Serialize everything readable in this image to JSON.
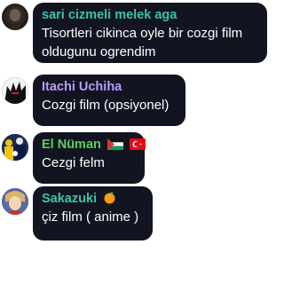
{
  "messages": [
    {
      "username": "sari cizmeli melek aga",
      "username_color": "#3fc1a8",
      "text_line1": "Tisortleri cikinca oyle bir cozgi film",
      "text_line2": "oldugunu ogrendim",
      "avatar_icon": "dark-profile-photo-icon"
    },
    {
      "username": "Itachi Uchiha",
      "username_color": "#b99cff",
      "text": "Cozgi film (opsiyonel)",
      "avatar_icon": "anime-dark-character-icon"
    },
    {
      "username": "El Nüman",
      "username_color": "#59cf61",
      "text": "Cezgi felm",
      "avatar_icon": "football-crowd-photo-icon",
      "badges": [
        "palestine-flag-icon",
        "turkey-flag-icon"
      ]
    },
    {
      "username": "Sakazuki",
      "username_color": "#3fc1a8",
      "text": "çiz film ( anime )",
      "avatar_icon": "anime-character-icon",
      "badge": "tangerine-icon"
    }
  ]
}
